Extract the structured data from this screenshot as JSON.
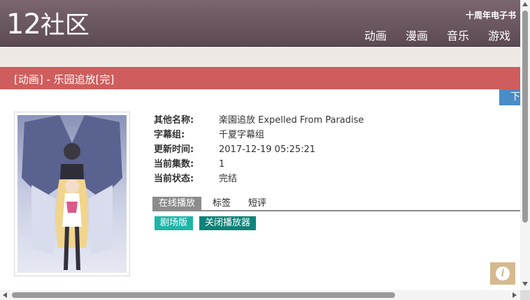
{
  "header": {
    "logo_num": "12",
    "logo_cn": "社区",
    "ebook_link": "十周年电子书",
    "nav": [
      "动画",
      "漫画",
      "音乐",
      "游戏"
    ]
  },
  "page": {
    "title": "[动画] - 乐园追放[完]",
    "download_button": "下"
  },
  "info": [
    {
      "label": "其他名称:",
      "value": "楽園追放 Expelled From Paradise"
    },
    {
      "label": "字幕组:",
      "value": "千夏字幕组"
    },
    {
      "label": "更新时间:",
      "value": "2017-12-19 05:25:21"
    },
    {
      "label": "当前集数:",
      "value": "1"
    },
    {
      "label": "当前状态:",
      "value": "完结"
    }
  ],
  "tabs": [
    "在线播放",
    "标签",
    "短评"
  ],
  "buttons": {
    "movie": "剧场版",
    "close_player": "关闭播放器"
  },
  "float_info_icon": "i",
  "colors": {
    "header": "#6b5760",
    "title_bar": "#cf5d5d",
    "download": "#4a8cc6",
    "teal": "#1eb5a9",
    "teal_dark": "#0e8378",
    "info_float": "#d5b98f"
  },
  "icons": {
    "info": "info-icon"
  }
}
